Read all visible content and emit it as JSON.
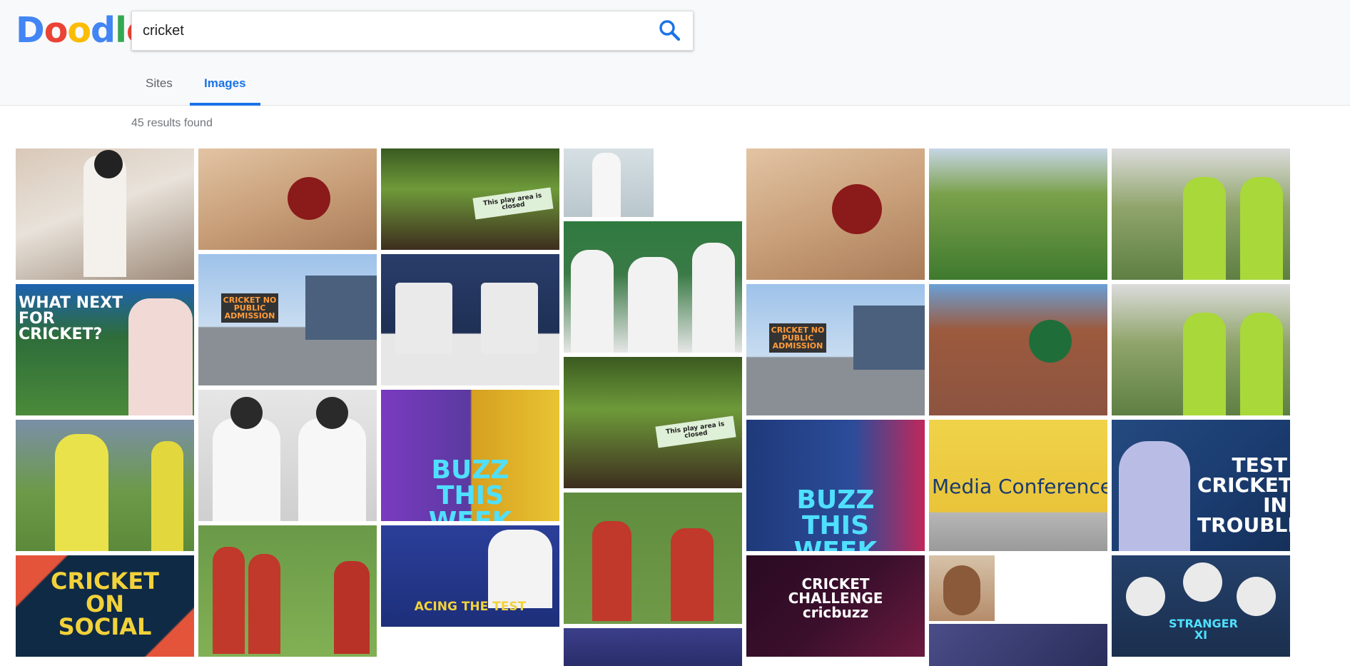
{
  "logo": {
    "letters": [
      {
        "ch": "D",
        "color": "#4285f4"
      },
      {
        "ch": "o",
        "color": "#ea4335"
      },
      {
        "ch": "o",
        "color": "#fbbc05"
      },
      {
        "ch": "d",
        "color": "#4285f4"
      },
      {
        "ch": "l",
        "color": "#34a853"
      },
      {
        "ch": "e",
        "color": "#ea4335"
      }
    ]
  },
  "search": {
    "value": "cricket",
    "icon": "search-icon"
  },
  "tabs": [
    {
      "label": "Sites",
      "active": false
    },
    {
      "label": "Images",
      "active": true
    }
  ],
  "results": {
    "count_text": "45 results found"
  },
  "images": {
    "tile_01": {
      "caption": "",
      "bg": "#b8a79a"
    },
    "tile_02": {
      "caption": "WHAT NEXT FOR CRICKET?",
      "bg": "#2e6d3a"
    },
    "tile_03": {
      "caption": "",
      "bg": "#6b8e3a"
    },
    "tile_04": {
      "caption": "CRICKET ON SOCIAL",
      "bg": "#0f2a44"
    },
    "tile_05": {
      "caption": "",
      "bg": "#c9a07a"
    },
    "tile_06": {
      "caption": "CRICKET NO PUBLIC ADMISSION",
      "bg": "#8fa9c8"
    },
    "tile_07": {
      "caption": "",
      "bg": "#dcdcdc"
    },
    "tile_08": {
      "caption": "",
      "bg": "#3f7b36"
    },
    "tile_09": {
      "caption": "This play area is closed",
      "bg": "#4d6a2e"
    },
    "tile_10": {
      "caption": "",
      "bg": "#1f3055"
    },
    "tile_11": {
      "caption": "BUZZ THIS WEEK",
      "bg": "#6a3aa0"
    },
    "tile_12": {
      "caption": "ACING THE TEST",
      "bg": "#1d2f7a"
    },
    "tile_13": {
      "caption": "",
      "bg": "#c5d2d6"
    },
    "tile_14": {
      "caption": "",
      "bg": "#3a7a46"
    },
    "tile_15": {
      "caption": "This play area is closed",
      "bg": "#4d6a2e"
    },
    "tile_16": {
      "caption": "",
      "bg": "#5f8c3e"
    },
    "tile_17": {
      "caption": "",
      "bg": "#3b3f8a"
    },
    "tile_18": {
      "caption": "",
      "bg": "#c9a07a"
    },
    "tile_19": {
      "caption": "CRICKET NO PUBLIC ADMISSION",
      "bg": "#8fa9c8"
    },
    "tile_20": {
      "caption": "BUZZ THIS WEEK",
      "bg": "#2c4c9a"
    },
    "tile_21": {
      "caption": "CRICKET CHALLENGE cricbuzz",
      "bg": "#3a0f2c"
    },
    "tile_22": {
      "caption": "",
      "bg": "#5e8f3a"
    },
    "tile_23": {
      "caption": "",
      "bg": "#8c5440"
    },
    "tile_24": {
      "caption": "Media Conference",
      "bg": "#e9c43a"
    },
    "tile_25": {
      "caption": "",
      "bg": "#b58c6a"
    },
    "tile_26": {
      "caption": "",
      "bg": "#4a4d88"
    },
    "tile_27": {
      "caption": "",
      "bg": "#5e7f43"
    },
    "tile_28": {
      "caption": "",
      "bg": "#5e7f43"
    },
    "tile_29": {
      "caption": "TEST CRICKET IN TROUBLE",
      "bg": "#1a3b6e"
    },
    "tile_30": {
      "caption": "STRANGER XI",
      "bg": "#1b2f4e"
    }
  }
}
